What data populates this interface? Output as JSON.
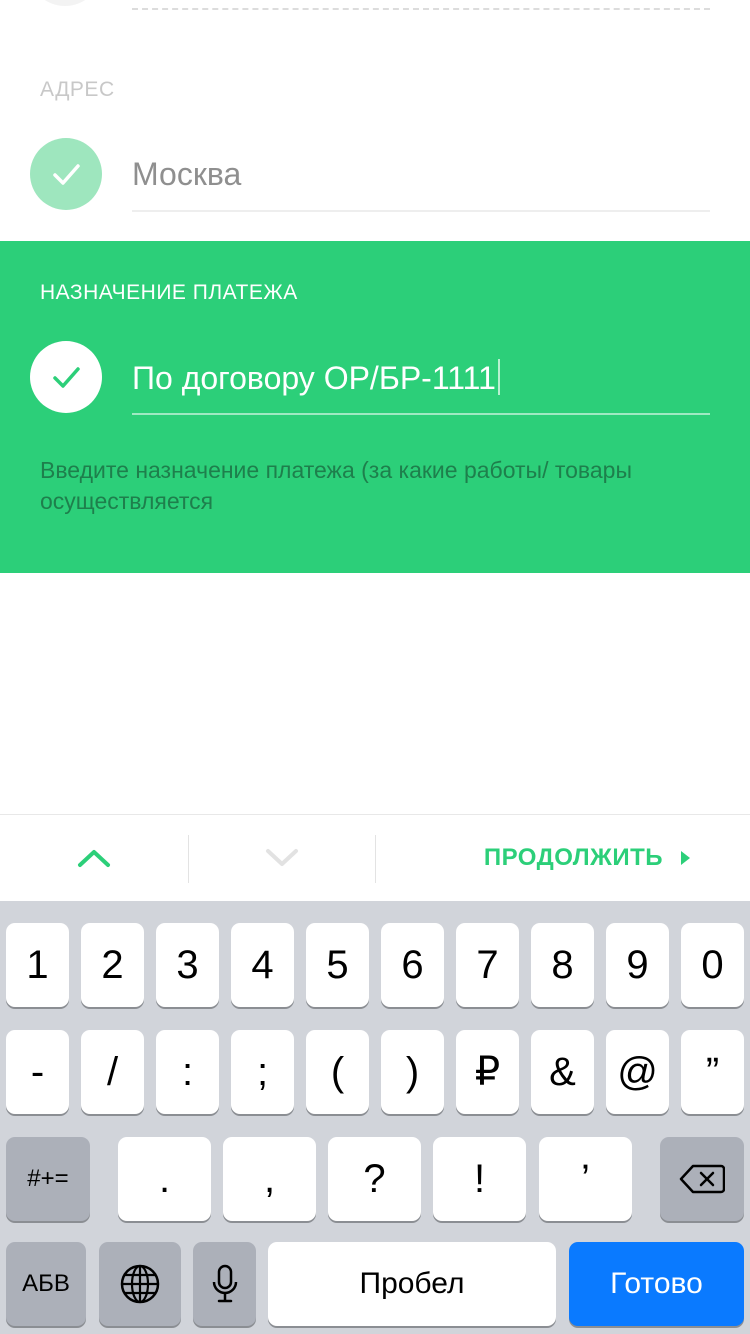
{
  "address": {
    "label": "АДРЕС",
    "value": "Москва"
  },
  "purpose": {
    "label": "НАЗНАЧЕНИЕ ПЛАТЕЖА",
    "value": "По договору ОР/БР-1111",
    "hint": "Введите назначение платежа (за какие работы/ товары осуществляется"
  },
  "toolbar": {
    "continue_label": "ПРОДОЛЖИТЬ"
  },
  "keyboard": {
    "row1": [
      "1",
      "2",
      "3",
      "4",
      "5",
      "6",
      "7",
      "8",
      "9",
      "0"
    ],
    "row2": [
      "-",
      "/",
      ":",
      ";",
      "(",
      ")",
      "₽",
      "&",
      "@",
      "”"
    ],
    "row3": {
      "mode": "#+=",
      "keys": [
        ".",
        ",",
        "?",
        "!",
        "’"
      ]
    },
    "row4": {
      "abc": "АБВ",
      "space": "Пробел",
      "done": "Готово"
    }
  },
  "colors": {
    "accent": "#2ccf79",
    "blue": "#0a7aff"
  }
}
